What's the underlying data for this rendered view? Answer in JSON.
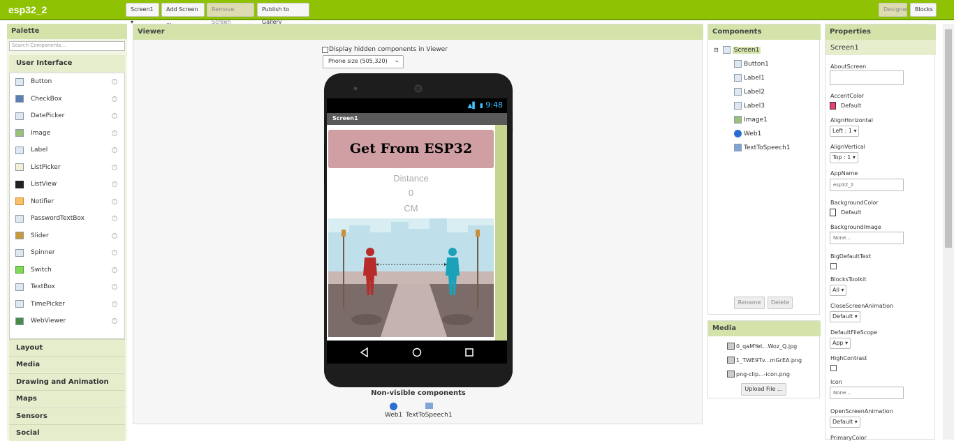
{
  "app": {
    "title": "esp32_2"
  },
  "toolbar": {
    "screen_select": "Screen1 ▾",
    "add_screen": "Add Screen ...",
    "remove_screen": "Remove Screen",
    "publish": "Publish to Gallery",
    "designer": "Designer",
    "blocks": "Blocks"
  },
  "palette": {
    "header": "Palette",
    "search_placeholder": "Search Components...",
    "ui_header": "User Interface",
    "items": [
      {
        "label": "Button",
        "icon": "button-icon"
      },
      {
        "label": "CheckBox",
        "icon": "checkbox-icon"
      },
      {
        "label": "DatePicker",
        "icon": "datepicker-icon"
      },
      {
        "label": "Image",
        "icon": "image-icon"
      },
      {
        "label": "Label",
        "icon": "label-icon"
      },
      {
        "label": "ListPicker",
        "icon": "listpicker-icon"
      },
      {
        "label": "ListView",
        "icon": "listview-icon"
      },
      {
        "label": "Notifier",
        "icon": "notifier-icon"
      },
      {
        "label": "PasswordTextBox",
        "icon": "passwordtextbox-icon"
      },
      {
        "label": "Slider",
        "icon": "slider-icon"
      },
      {
        "label": "Spinner",
        "icon": "spinner-icon"
      },
      {
        "label": "Switch",
        "icon": "switch-icon"
      },
      {
        "label": "TextBox",
        "icon": "textbox-icon"
      },
      {
        "label": "TimePicker",
        "icon": "timepicker-icon"
      },
      {
        "label": "WebViewer",
        "icon": "webviewer-icon"
      }
    ],
    "categories": [
      "Layout",
      "Media",
      "Drawing and Animation",
      "Maps",
      "Sensors",
      "Social"
    ]
  },
  "viewer": {
    "header": "Viewer",
    "hidden_toggle": "Display hidden components in Viewer",
    "phone_size": "Phone size (505,320)",
    "status_time": "9:48",
    "screen_title": "Screen1",
    "button_text": "Get From ESP32",
    "label1": "Distance",
    "label2": "0",
    "label3": "CM",
    "nonvisible_header": "Non-visible components",
    "nonvisible": [
      "Web1",
      "TextToSpeech1"
    ]
  },
  "components": {
    "header": "Components",
    "root": "Screen1",
    "children": [
      "Button1",
      "Label1",
      "Label2",
      "Label3",
      "Image1",
      "Web1",
      "TextToSpeech1"
    ],
    "rename": "Rename",
    "delete": "Delete"
  },
  "media": {
    "header": "Media",
    "files": [
      "0_qaMYet...Woz_Q.jpg",
      "1_TWE9Tv...mGrEA.png",
      "png-clip...-icon.png"
    ],
    "upload": "Upload File ..."
  },
  "properties": {
    "header": "Properties",
    "component": "Screen1",
    "about_screen_label": "AboutScreen",
    "accent_label": "AccentColor",
    "accent_value": "Default",
    "accent_color": "#e5436d",
    "align_h_label": "AlignHorizontal",
    "align_h_value": "Left : 1 ▾",
    "align_v_label": "AlignVertical",
    "align_v_value": "Top : 1 ▾",
    "appname_label": "AppName",
    "appname_value": "esp32_2",
    "bgcolor_label": "BackgroundColor",
    "bgcolor_value": "Default",
    "bgimage_label": "BackgroundImage",
    "bgimage_value": "None...",
    "bigtext_label": "BigDefaultText",
    "blocks_toolkit_label": "BlocksToolkit",
    "blocks_toolkit_value": "All ▾",
    "close_anim_label": "CloseScreenAnimation",
    "close_anim_value": "Default ▾",
    "filescope_label": "DefaultFileScope",
    "filescope_value": "App ▾",
    "high_contrast_label": "HighContrast",
    "icon_label": "Icon",
    "icon_value": "None...",
    "open_anim_label": "OpenScreenAnimation",
    "open_anim_value": "Default ▾",
    "primary_label": "PrimaryColor"
  }
}
